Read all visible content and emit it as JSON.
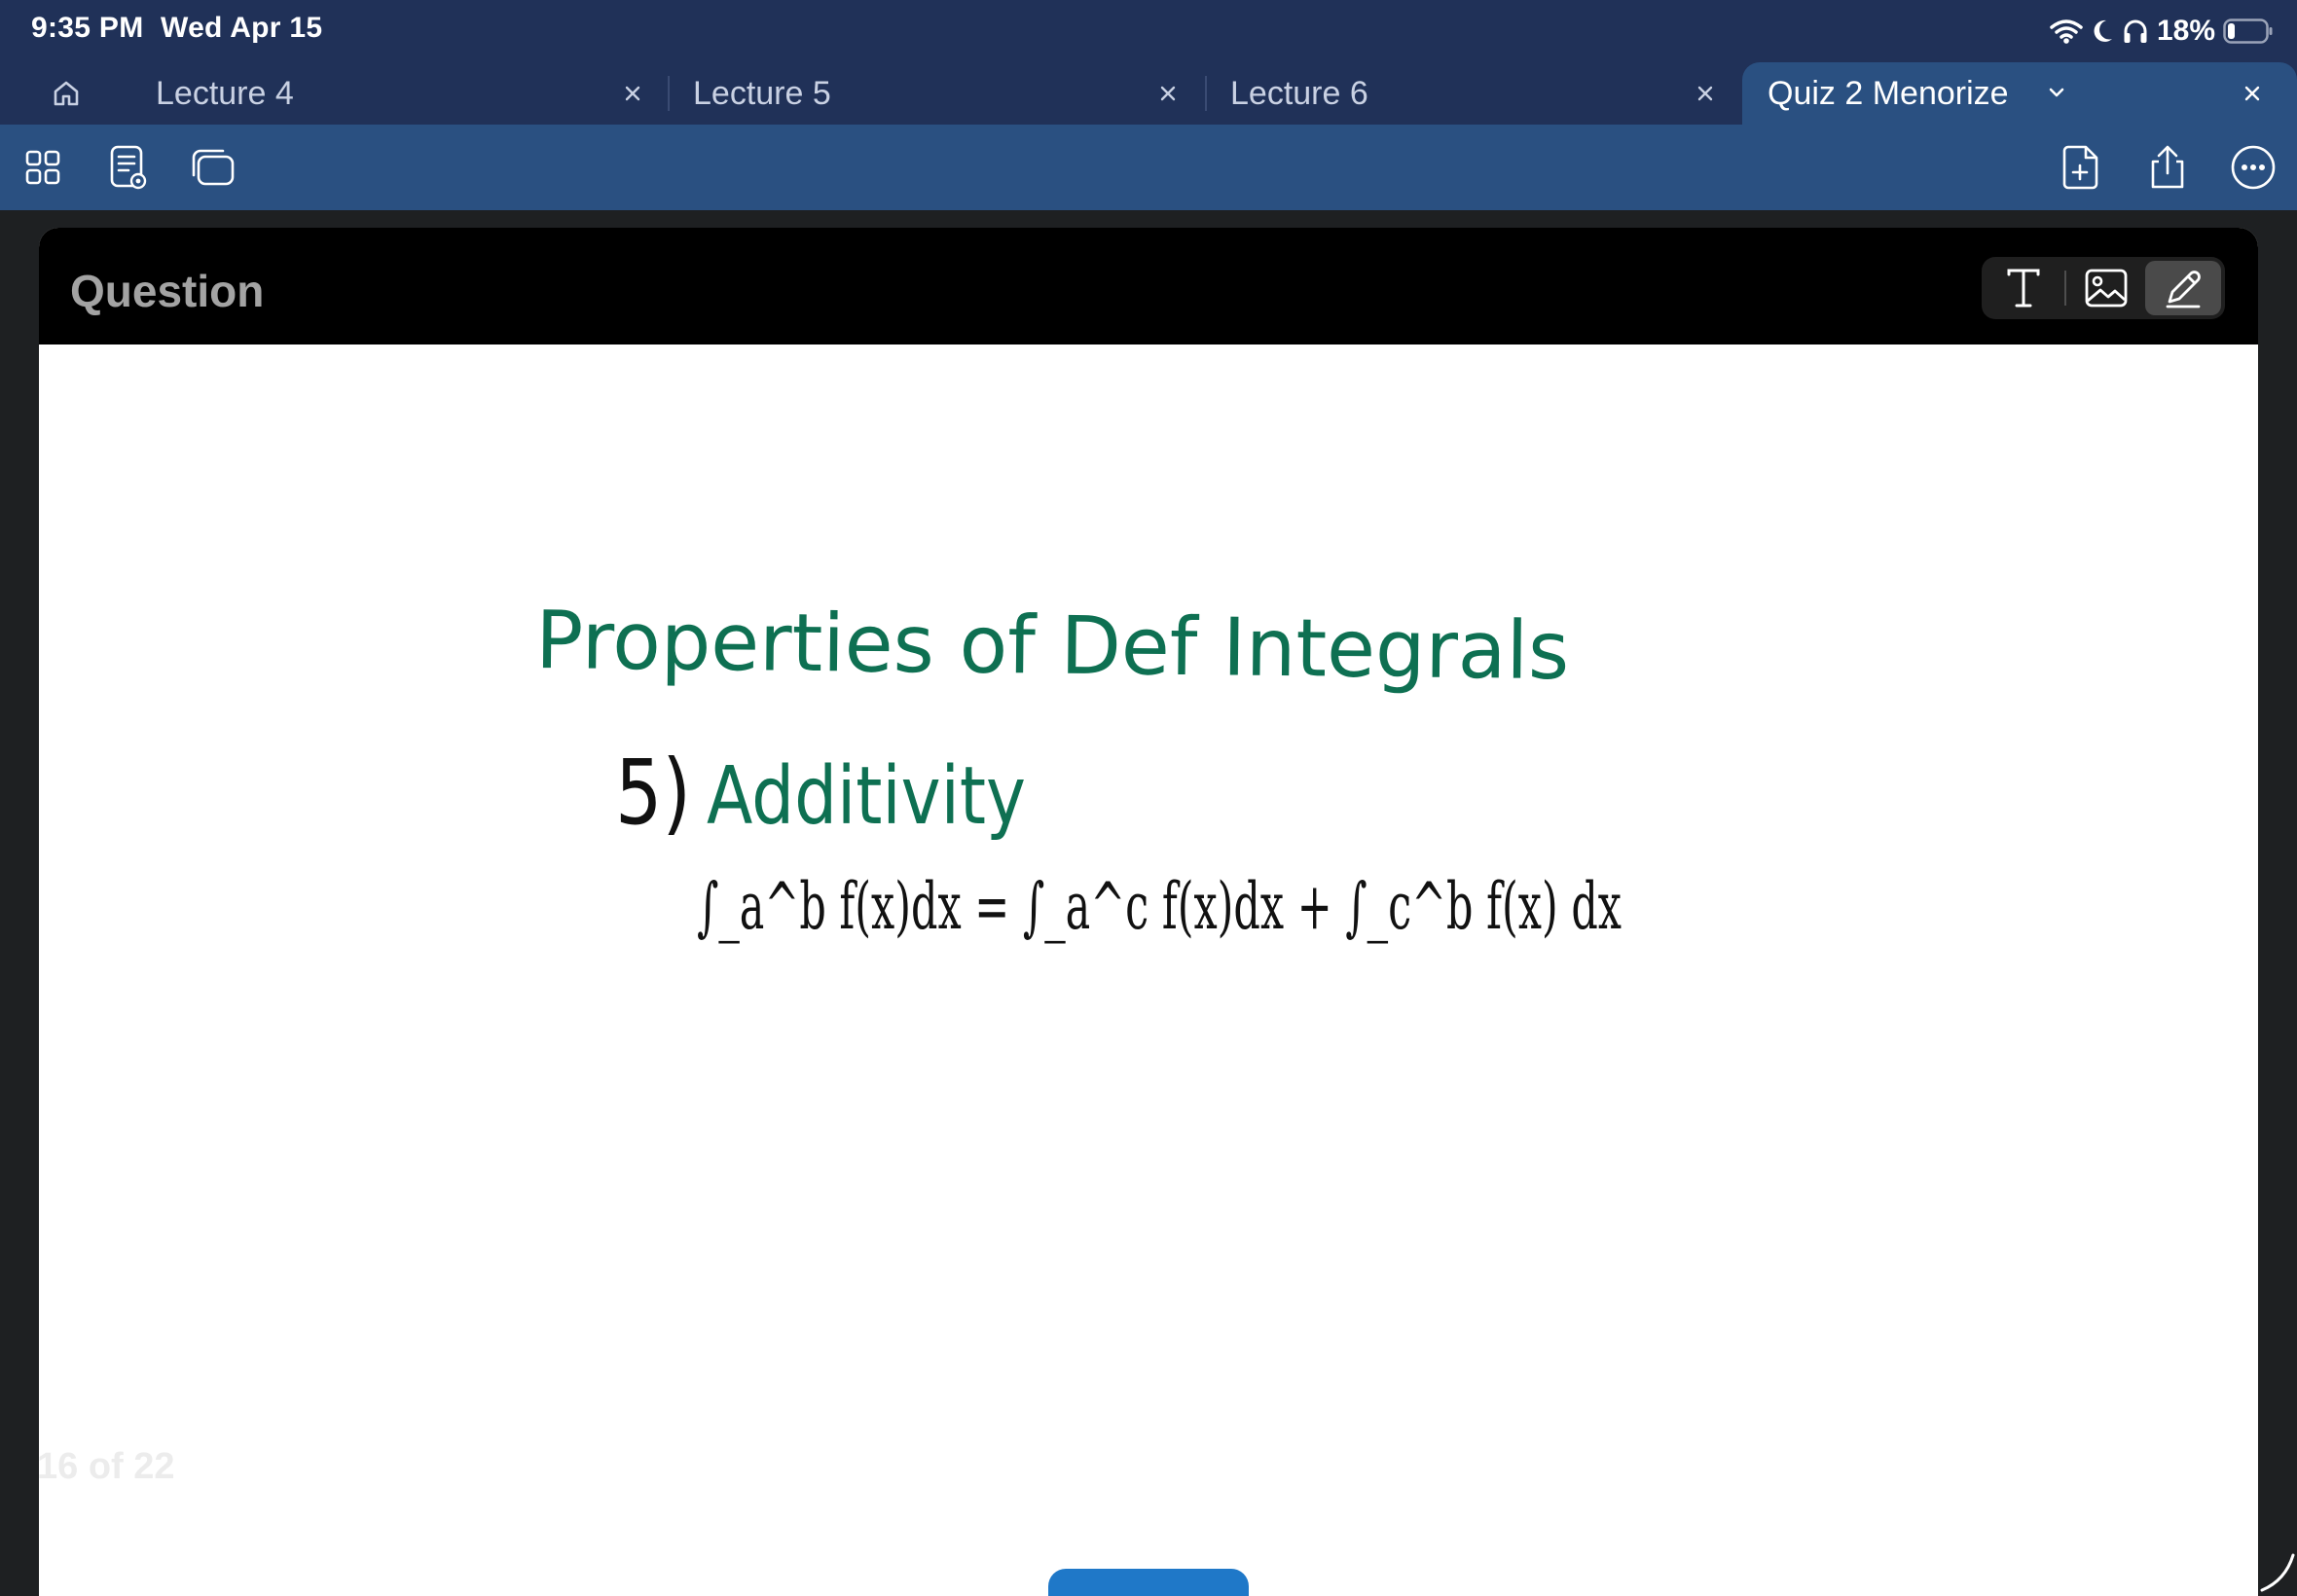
{
  "status_bar": {
    "time": "9:35 PM",
    "date": "Wed Apr 15",
    "battery_percent": "18%",
    "battery_level": 0.18,
    "icons": [
      "wifi-icon",
      "moon-icon",
      "headphones-icon",
      "battery-icon"
    ]
  },
  "tabs": {
    "home_icon": "home-icon",
    "items": [
      {
        "label": "Lecture 4",
        "active": false
      },
      {
        "label": "Lecture 5",
        "active": false
      },
      {
        "label": "Lecture 6",
        "active": false
      },
      {
        "label": "Quiz 2 Menorize",
        "active": true
      }
    ]
  },
  "toolbar": {
    "left_icons": [
      "grid-icon",
      "note-preview-icon",
      "cards-icon"
    ],
    "right_icons": [
      "add-page-icon",
      "share-icon",
      "more-icon"
    ]
  },
  "card": {
    "title": "Question",
    "input_modes": [
      "text-mode-icon",
      "image-mode-icon",
      "pen-mode-icon"
    ],
    "active_mode": "pen",
    "handwriting": {
      "heading": "Properties of Def Integrals",
      "item_number": "5)",
      "item_title": "Additivity",
      "formula": "∫_a^b f(x)dx = ∫_a^c f(x)dx + ∫_c^b f(x) dx",
      "ink_colors": {
        "heading": "#0e7052",
        "formula": "#111111"
      }
    },
    "page_counter": "16 of 22"
  },
  "colors": {
    "status_bg": "#203158",
    "toolbar_bg": "#2a5081",
    "card_header_bg": "#000000",
    "accent_button": "#1f78c8"
  }
}
